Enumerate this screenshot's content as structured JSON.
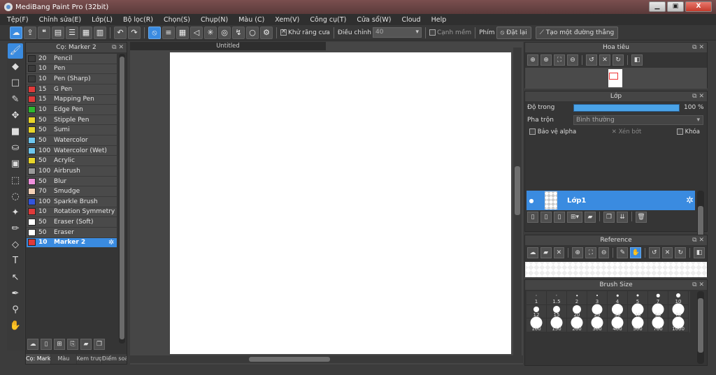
{
  "window": {
    "title": "MediBang Paint Pro (32bit)",
    "buttons": [
      "▁",
      "▣",
      "X"
    ]
  },
  "menu": [
    "Tệp(F)",
    "Chỉnh sửa(E)",
    "Lớp(L)",
    "Bộ lọc(R)",
    "Chọn(S)",
    "Chụp(N)",
    "Màu (C)",
    "Xem(V)",
    "Công cụ(T)",
    "Cửa sổ(W)",
    "Cloud",
    "Help"
  ],
  "toolbar": {
    "antialias_label": "Khử răng cưa",
    "antialias_checked": true,
    "correction_label": "Điều chỉnh",
    "correction_value": "40",
    "soft_edge_label": "Cạnh mềm",
    "soft_edge_checked": false,
    "key_label": "Phím",
    "reset_label": "Đặt lại",
    "create_line_label": "Tạo một đường thẳng",
    "accent_color": "#3a8be0"
  },
  "tools": [
    "brush-icon",
    "eraser-icon",
    "rectangle-icon",
    "pen-stroke-icon",
    "move-icon",
    "fill-rect-icon",
    "bucket-icon",
    "gradient-icon",
    "select-rect-icon",
    "lasso-icon",
    "magic-wand-icon",
    "select-pen-icon",
    "select-eraser-icon",
    "text-icon",
    "operation-icon",
    "divide-icon",
    "eyedropper-icon",
    "hand-icon"
  ],
  "brush_panel": {
    "title": "Cọ: Marker 2",
    "items": [
      {
        "size": "20",
        "name": "Pencil",
        "color": "#3a3a3a"
      },
      {
        "size": "10",
        "name": "Pen",
        "color": "#3a3a3a"
      },
      {
        "size": "10",
        "name": "Pen (Sharp)",
        "color": "#3a3a3a"
      },
      {
        "size": "15",
        "name": "G Pen",
        "color": "#e03a3a"
      },
      {
        "size": "15",
        "name": "Mapping Pen",
        "color": "#e03a3a"
      },
      {
        "size": "10",
        "name": "Edge Pen",
        "color": "#2eb82e"
      },
      {
        "size": "50",
        "name": "Stipple Pen",
        "color": "#e8d52a"
      },
      {
        "size": "50",
        "name": "Sumi",
        "color": "#e8d52a"
      },
      {
        "size": "50",
        "name": "Watercolor",
        "color": "#6ec6ee"
      },
      {
        "size": "100",
        "name": "Watercolor (Wet)",
        "color": "#6ec6ee"
      },
      {
        "size": "50",
        "name": "Acrylic",
        "color": "#e8d52a"
      },
      {
        "size": "100",
        "name": "Airbrush",
        "color": "#9a9a9a"
      },
      {
        "size": "50",
        "name": "Blur",
        "color": "#f090dc"
      },
      {
        "size": "70",
        "name": "Smudge",
        "color": "#f5d2b8"
      },
      {
        "size": "100",
        "name": "Sparkle Brush",
        "color": "#3355dd"
      },
      {
        "size": "10",
        "name": "Rotation Symmetry Pe",
        "color": "#e03a3a"
      },
      {
        "size": "50",
        "name": "Eraser (Soft)",
        "color": "#ffffff"
      },
      {
        "size": "50",
        "name": "Eraser",
        "color": "#ffffff"
      },
      {
        "size": "10",
        "name": "Marker 2",
        "color": "#e03a3a",
        "selected": true
      }
    ],
    "tabs": [
      "Cọ: Mark...",
      "Màu",
      "Kem trượ...",
      "Điểm soá..."
    ]
  },
  "canvas": {
    "doc_tab": "Untitled"
  },
  "navigator": {
    "title": "Hoa tiêu"
  },
  "layers": {
    "title": "Lớp",
    "opacity_label": "Độ trong",
    "opacity_value": "100 %",
    "opacity_fraction": 1.0,
    "blend_label": "Pha trộn",
    "blend_value": "Bình thường",
    "protect_alpha": "Bảo vệ alpha",
    "clipping": "Xén bớt",
    "lock": "Khóa",
    "layer_name": "Lớp1"
  },
  "reference": {
    "title": "Reference"
  },
  "brush_size": {
    "title": "Brush Size",
    "sizes": [
      "1",
      "1.5",
      "2",
      "3",
      "4",
      "5",
      "7",
      "10",
      "12",
      "15",
      "20",
      "25",
      "30",
      "40",
      "50",
      "70",
      "100",
      "150",
      "200",
      "300",
      "400",
      "500",
      "700",
      "1000"
    ]
  }
}
